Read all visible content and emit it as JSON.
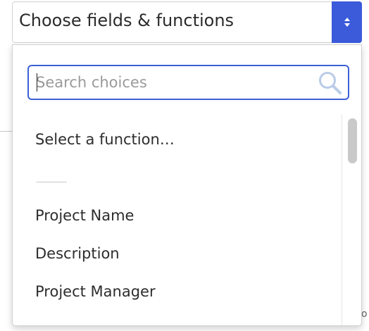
{
  "select": {
    "value": "Choose fields & functions",
    "arrow_icon": "sort-arrows-icon"
  },
  "search": {
    "placeholder": "Search choices",
    "value": "",
    "icon": "search-icon"
  },
  "options": [
    {
      "label": "Select a function…"
    },
    {
      "label": "-------------"
    },
    {
      "label": "Project Name"
    },
    {
      "label": "Description"
    },
    {
      "label": "Project Manager"
    }
  ],
  "colors": {
    "accent": "#3b5bdb",
    "focus_border": "#3c60d6"
  }
}
